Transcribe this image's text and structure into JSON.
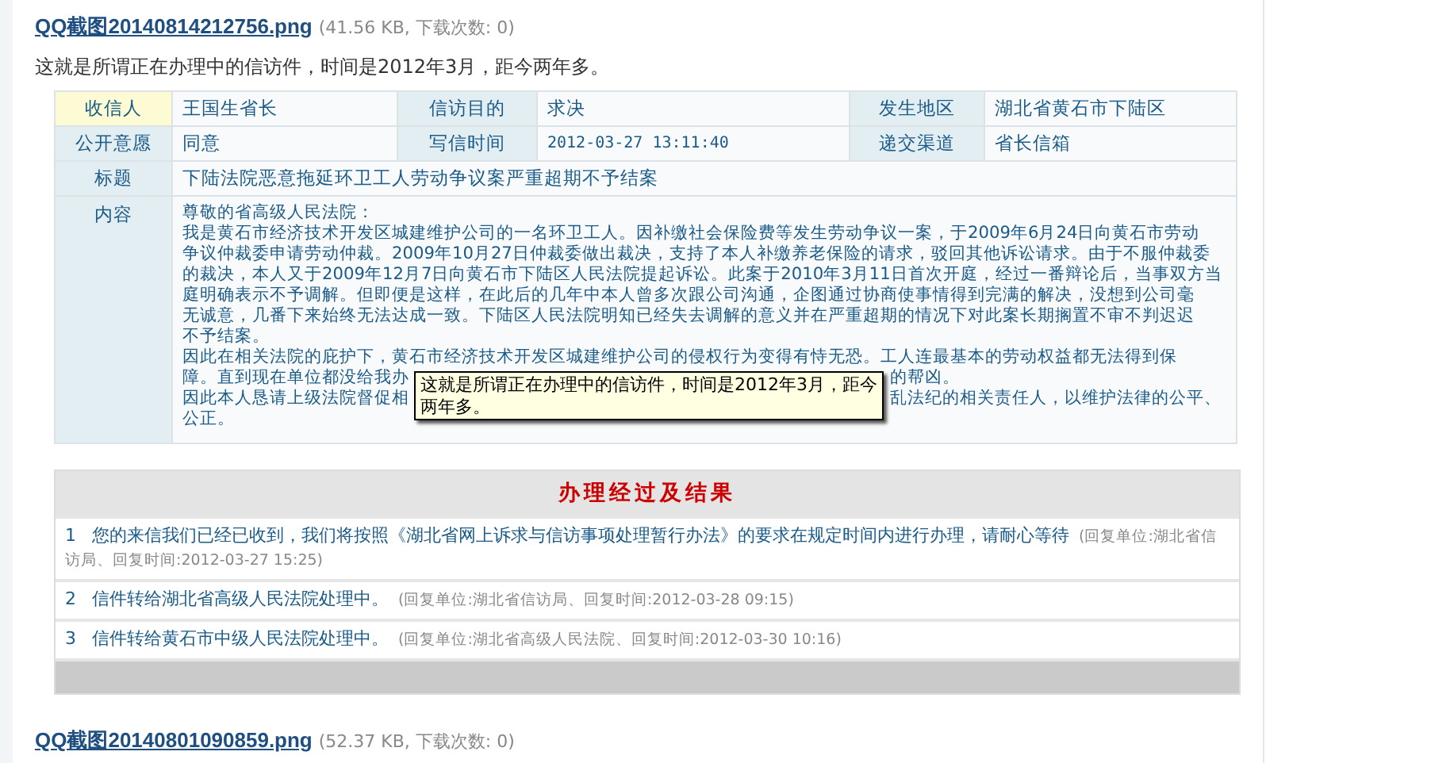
{
  "attachment": {
    "filename": "QQ截图20140814212756.png",
    "info": "(41.56 KB, 下载次数: 0)"
  },
  "caption": "这就是所谓正在办理中的信访件，时间是2012年3月，距今两年多。",
  "letter": {
    "fields": [
      {
        "kind": "text",
        "label": "收信人",
        "highlighted": true,
        "value": "王国生省长"
      },
      {
        "kind": "text",
        "label": "信访目的",
        "highlighted": false,
        "value": "求决"
      },
      {
        "kind": "text",
        "label": "发生地区",
        "highlighted": false,
        "value": "湖北省黄石市下陆区"
      },
      {
        "kind": "text",
        "label": "公开意愿",
        "highlighted": false,
        "value": "同意"
      },
      {
        "kind": "mono",
        "label": "写信时间",
        "highlighted": false,
        "value": "2012-03-27 13:11:40"
      },
      {
        "kind": "text",
        "label": "递交渠道",
        "highlighted": false,
        "value": "省长信箱"
      },
      {
        "kind": "wide",
        "label": "标题",
        "highlighted": false,
        "value": "下陆法院恶意拖延环卫工人劳动争议案严重超期不予结案"
      }
    ],
    "content_label": "内容",
    "content_lines": [
      {
        "text": "尊敬的省高级人民法院："
      },
      {
        "text": "我是黄石市经济技术开发区城建维护公司的一名环卫工人。因补缴社会保险费等发生劳动争议一案，于2009年6月24日向黄石市劳动"
      },
      {
        "text": "争议仲裁委申请劳动仲裁。2009年10月27日仲裁委做出裁决，支持了本人补缴养老保险的请求，驳回其他诉讼请求。由于不服仲裁委"
      },
      {
        "text": "的裁决，本人又于2009年12月7日向黄石市下陆区人民法院提起诉讼。此案于2010年3月11日首次开庭，经过一番辩论后，当事双方当"
      },
      {
        "text": "庭明确表示不予调解。但即便是这样，在此后的几年中本人曾多次跟公司沟通，企图通过协商使事情得到完满的解决，没想到公司毫"
      },
      {
        "text": "无诚意，几番下来始终无法达成一致。下陆区人民法院明知已经失去调解的意义并在严重超期的情况下对此案长期搁置不审不判迟迟"
      },
      {
        "text": "不予结案。"
      },
      {
        "text": "因此在相关法院的庇护下，黄石市经济技术开发区城建维护公司的侵权行为变得有恃无恐。工人连最基本的劳动权益都无法得到保"
      },
      {
        "text": "障。直到现在单位都没给我办",
        "after": "的帮凶。"
      },
      {
        "text": "因此本人恳请上级法院督促相",
        "after": "乱法纪的相关责任人，以维护法律的公平、"
      },
      {
        "text": "公正。"
      }
    ],
    "tooltip": "这就是所谓正在办理中的信访件，时间是2012年3月，距今两年多。"
  },
  "process": {
    "title": "办理经过及结果",
    "items": [
      {
        "number": "1",
        "text": "您的来信我们已经已收到，我们将按照《湖北省网上诉求与信访事项处理暂行办法》的要求在规定时间内进行办理，请耐心等待",
        "meta": "(回复单位:湖北省信访局、回复时间:2012-03-27 15:25)"
      },
      {
        "number": "2",
        "text": "信件转给湖北省高级人民法院处理中。",
        "meta": "(回复单位:湖北省信访局、回复时间:2012-03-28 09:15)"
      },
      {
        "number": "3",
        "text": "信件转给黄石市中级人民法院处理中。",
        "meta": "(回复单位:湖北省高级人民法院、回复时间:2012-03-30 10:16)"
      }
    ]
  },
  "next_attachment": {
    "filename": "QQ截图20140801090859.png",
    "info": "(52.37 KB, 下载次数: 0)"
  }
}
